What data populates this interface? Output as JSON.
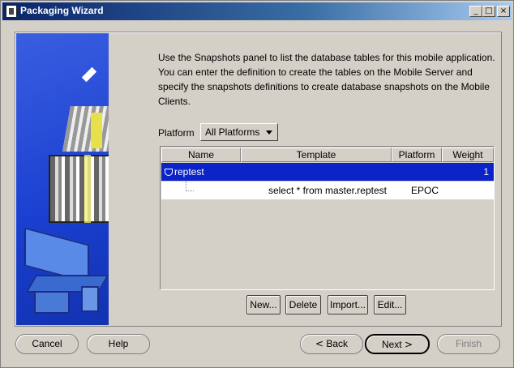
{
  "window": {
    "title": "Packaging Wizard",
    "minimize": "_",
    "maximize": "□",
    "close": "×"
  },
  "intro_text": "Use the Snapshots panel to list the database tables for this mobile application. You can enter the definition to create the tables on the Mobile Server and specify the snapshots definitions to create database snapshots on the Mobile Clients.",
  "platform": {
    "label": "Platform",
    "selected": "All Platforms"
  },
  "table": {
    "columns": [
      "Name",
      "Template",
      "Platform",
      "Weight"
    ],
    "rows": [
      {
        "name": "reptest",
        "template": "",
        "platform": "",
        "weight": "1",
        "selected": true
      },
      {
        "name": "",
        "template": "select * from master.reptest",
        "platform": "EPOC",
        "weight": ""
      }
    ]
  },
  "actions": {
    "new": "New...",
    "delete": "Delete",
    "import": "Import...",
    "edit": "Edit..."
  },
  "nav": {
    "cancel": "Cancel",
    "help": "Help",
    "back": "Back",
    "back_arrow": "<",
    "next": "Next",
    "next_arrow": ">",
    "finish": "Finish"
  },
  "colors": {
    "selection": "#0a24c8",
    "titlebar": "#0a246a"
  }
}
